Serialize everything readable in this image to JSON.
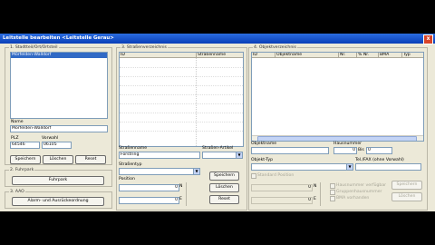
{
  "window": {
    "title": "Leitstelle bearbeiten <Leitstelle Gerau>",
    "close_label": "x"
  },
  "section1": {
    "title": "1. Stadtteil/Ort/Ortsteil",
    "list_items": [
      "Mörfelden-Walldorf"
    ],
    "name_label": "Name",
    "name_value": "Mörfelden-Walldorf",
    "plz_label": "PLZ",
    "plz_value": "64546",
    "vorwahl_label": "Vorwahl",
    "vorwahl_value": "06105",
    "buttons": [
      "Speichern",
      "Löschen",
      "Reset"
    ]
  },
  "section2": {
    "title": "2. Fuhrpark",
    "button": "Fuhrpark"
  },
  "section3": {
    "title": "3. AAO",
    "button": "Alarm- und Ausrückeordnung"
  },
  "section4": {
    "title": "3. Straßenverzeichnis",
    "columns": [
      "ID",
      "Straßenname"
    ],
    "strassenname_label": "Straßenname",
    "strassenname_value": "Forstring",
    "artikel_label": "Straßen-Artikel",
    "typ_label": "Straßentyp",
    "position_label": "Position",
    "pos1_value": "0",
    "pos1_unit": "N",
    "pos2_value": "0",
    "pos2_unit": "E",
    "buttons": [
      "Speichern",
      "Löschen",
      "Reset"
    ]
  },
  "section5": {
    "title": "4. Objektverzeichnis",
    "columns": [
      "ID",
      "Objektname",
      "Nr.",
      "% Nr.",
      "BMA",
      "Typ"
    ],
    "objektname_label": "Objektname",
    "hausnummer_label": "Hausnummer",
    "nr_value": "0",
    "bis_label": "Bis",
    "bis_value": "0",
    "objekttyp_label": "Objekt-Typ",
    "tel_label": "Tel./FAX (ohne Vorwahl)",
    "standard_label": "Standard Position",
    "pos1_value": "0",
    "pos1_unit": "N",
    "pos2_value": "0",
    "pos2_unit": "E",
    "checkboxes": [
      "Hausnummer verfügbar",
      "Gruppenhausnummer",
      "BMA vorhanden"
    ],
    "buttons": [
      "Speichern",
      "Löschen"
    ]
  }
}
